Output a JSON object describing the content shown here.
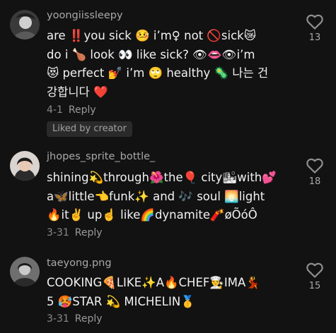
{
  "comments": [
    {
      "username": "yoongiissleepy",
      "text": "are ‼️you sick 🤒 i’m♀ not 🚫sick😿\ndo i 🍗 look 👀 like sick? 👁👄👁i’m\n😻 perfect 💅 i’m 🙄 healthy 🦠 나는 건\n강합니다 ❤️",
      "date": "4-1",
      "reply_label": "Reply",
      "badge": "Liked by creator",
      "likes": "13"
    },
    {
      "username": "jhopes_sprite_bottle_",
      "text": "shining💫through🌺the🎈 city🏙with💕\na🦋little👈funk✨ and 🎶 soul 🌅light\n🔥it✌️ up☝️ like🌈dynamite🧨øÕóÔ",
      "date": "3-31",
      "reply_label": "Reply",
      "likes": "18"
    },
    {
      "username": "taeyong.png",
      "text": "COOKING🍕LIKE✨A🔥CHEF👨‍🍳IMA💃\n5 🥵STAR 💫 MICHELIN🥇",
      "date": "3-31",
      "reply_label": "Reply",
      "likes": "15"
    }
  ],
  "icons": {
    "like": "heart-outline-icon"
  },
  "colors": {
    "background": "#121212",
    "username": "#a8a8a8",
    "meta": "#8a8a8a",
    "badge_bg": "#2a2a2a"
  }
}
